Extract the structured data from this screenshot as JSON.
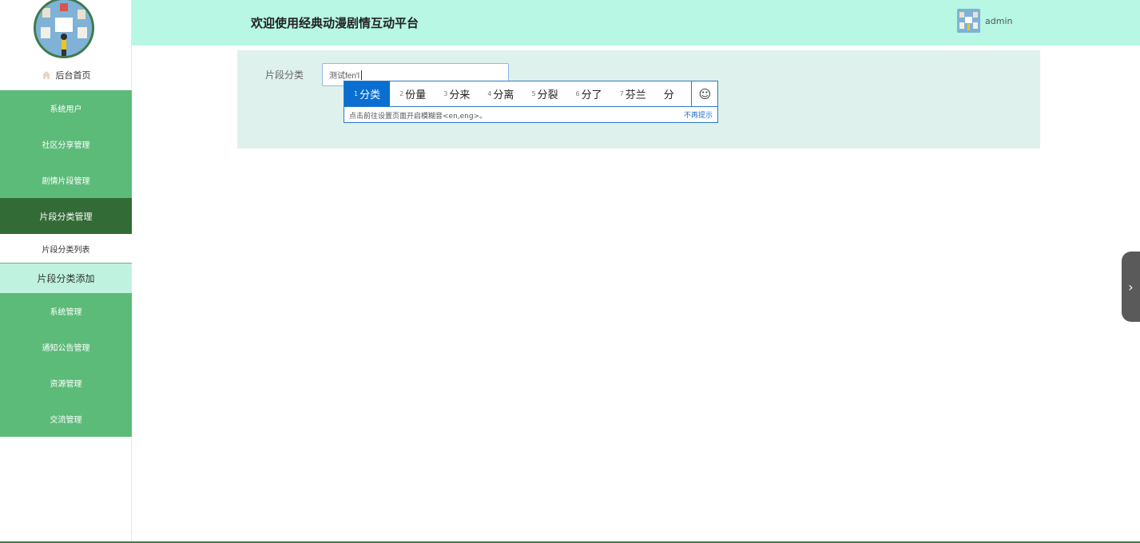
{
  "header": {
    "title": "欢迎使用经典动漫剧情互动平台",
    "username": "admin"
  },
  "sidebar": {
    "home_label": "后台首页",
    "menu": [
      {
        "label": "系统用户"
      },
      {
        "label": "社区分享管理"
      },
      {
        "label": "剧情片段管理"
      },
      {
        "label": "片段分类管理",
        "active": true
      }
    ],
    "submenu": [
      {
        "label": "片段分类列表"
      },
      {
        "label": "片段分类添加",
        "current": true
      }
    ],
    "menu_after": [
      {
        "label": "系统管理"
      },
      {
        "label": "通知公告管理"
      },
      {
        "label": "资源管理"
      },
      {
        "label": "交流管理"
      }
    ]
  },
  "form": {
    "label": "片段分类",
    "input_value": "测试fen'l"
  },
  "ime": {
    "candidates": [
      {
        "num": "1",
        "text": "分类"
      },
      {
        "num": "2",
        "text": "份量"
      },
      {
        "num": "3",
        "text": "分来"
      },
      {
        "num": "4",
        "text": "分离"
      },
      {
        "num": "5",
        "text": "分裂"
      },
      {
        "num": "6",
        "text": "分了"
      },
      {
        "num": "7",
        "text": "芬兰"
      },
      {
        "num": "",
        "text": "分"
      }
    ],
    "emoji": "☺",
    "hint": "点击前往设置页面开启模糊音<en,eng>。",
    "dismiss": "不再提示"
  },
  "drawer_toggle": "›",
  "colors": {
    "header_bg": "#b7f7e3",
    "menu_bg": "#5dbb79",
    "menu_active_bg": "#336b36",
    "submenu_current_bg": "#bff3df",
    "panel_bg": "#dff1ec",
    "ime_selected": "#0a6fd0"
  }
}
